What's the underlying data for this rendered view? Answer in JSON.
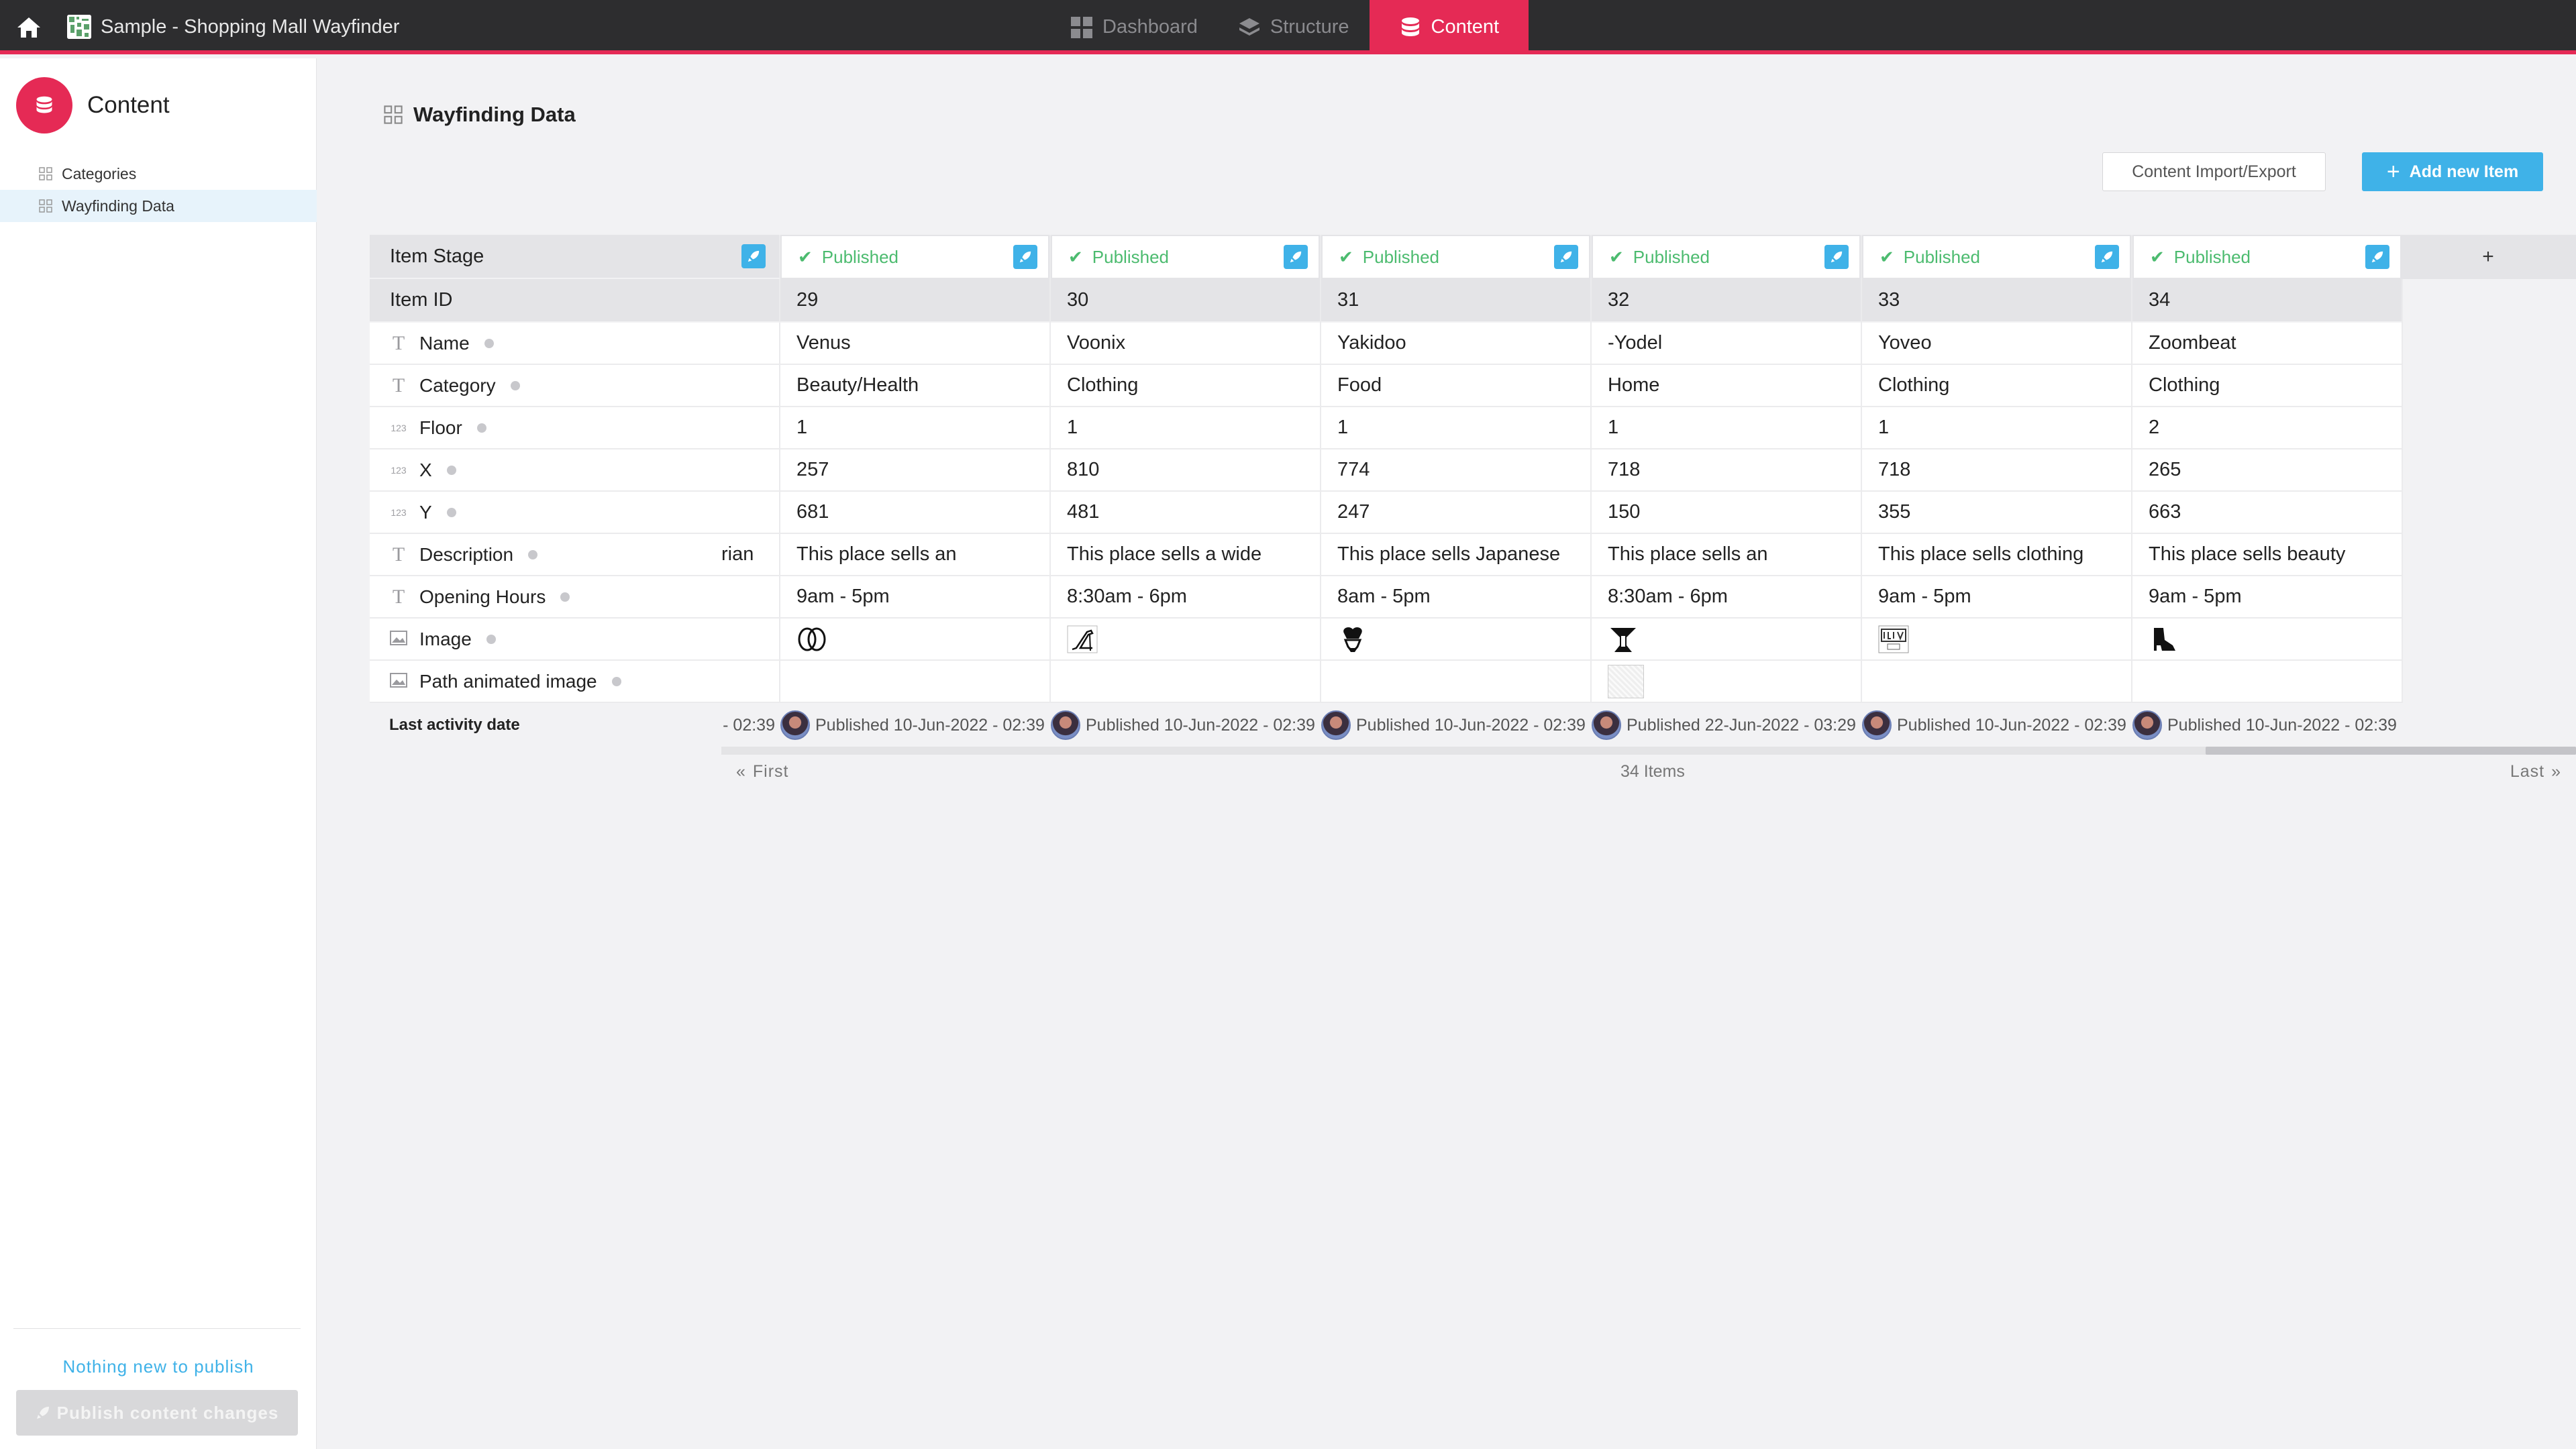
{
  "app": {
    "title": "Sample - Shopping Mall Wayfinder"
  },
  "nav": {
    "dashboard": "Dashboard",
    "structure": "Structure",
    "content": "Content"
  },
  "sidebar": {
    "heading": "Content",
    "items": [
      {
        "label": "Categories"
      },
      {
        "label": "Wayfinding Data"
      }
    ],
    "status": "Nothing new to publish",
    "publish_label": "Publish content changes"
  },
  "page": {
    "title": "Wayfinding Data",
    "import_label": "Content Import/Export",
    "add_label": "Add new Item"
  },
  "table": {
    "row_labels": {
      "stage": "Item Stage",
      "item_id": "Item ID",
      "name": "Name",
      "category": "Category",
      "floor": "Floor",
      "x": "X",
      "y": "Y",
      "description": "Description",
      "opening_hours": "Opening Hours",
      "image": "Image",
      "path_image": "Path animated image",
      "last_activity": "Last activity date"
    },
    "partial": {
      "description": "rian",
      "activity": "- 02:39"
    },
    "items": [
      {
        "stage": "Published",
        "id": "29",
        "name": "Venus",
        "category": "Beauty/Health",
        "floor": "1",
        "x": "257",
        "y": "681",
        "description": "This place sells an",
        "hours": "9am - 5pm",
        "activity": "Published 10-Jun-2022 - 02:39"
      },
      {
        "stage": "Published",
        "id": "30",
        "name": "Voonix",
        "category": "Clothing",
        "floor": "1",
        "x": "810",
        "y": "481",
        "description": "This place sells a wide",
        "hours": "8:30am - 6pm",
        "activity": "Published 10-Jun-2022 - 02:39"
      },
      {
        "stage": "Published",
        "id": "31",
        "name": "Yakidoo",
        "category": "Food",
        "floor": "1",
        "x": "774",
        "y": "247",
        "description": "This place sells Japanese",
        "hours": "8am - 5pm",
        "activity": "Published 10-Jun-2022 - 02:39"
      },
      {
        "stage": "Published",
        "id": "32",
        "name": "-Yodel",
        "category": "Home",
        "floor": "1",
        "x": "718",
        "y": "150",
        "description": "This place sells an",
        "hours": "8:30am - 6pm",
        "activity": "Published 22-Jun-2022 - 03:29"
      },
      {
        "stage": "Published",
        "id": "33",
        "name": "Yoveo",
        "category": "Clothing",
        "floor": "1",
        "x": "718",
        "y": "355",
        "description": "This place sells clothing",
        "hours": "9am - 5pm",
        "activity": "Published 10-Jun-2022 - 02:39"
      },
      {
        "stage": "Published",
        "id": "34",
        "name": "Zoombeat",
        "category": "Clothing",
        "floor": "2",
        "x": "265",
        "y": "663",
        "description": "This place sells beauty",
        "hours": "9am - 5pm",
        "activity": "Published 10-Jun-2022 - 02:39"
      }
    ],
    "add_column": "+"
  },
  "pager": {
    "first": "First",
    "count": "34 Items",
    "last": "Last"
  },
  "colors": {
    "accent": "#e52a55",
    "topbar": "#2d2d2f",
    "primary": "#3fb2e8",
    "published": "#4cbb6f"
  }
}
